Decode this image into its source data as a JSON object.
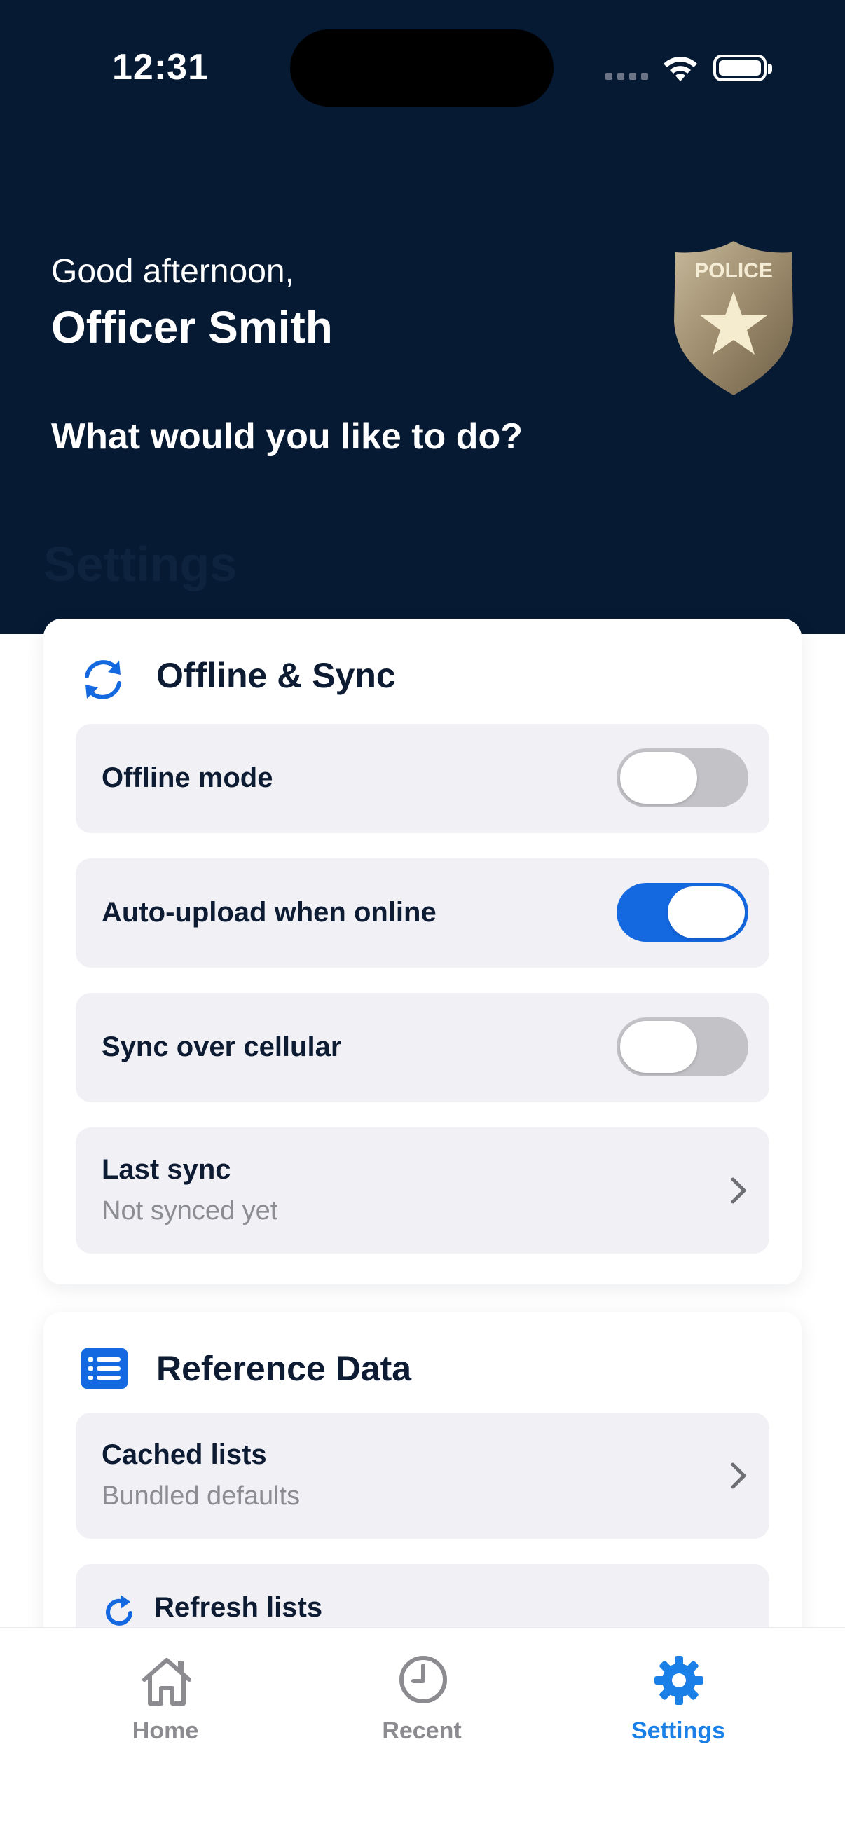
{
  "status_bar": {
    "time": "12:31"
  },
  "header": {
    "greeting": "Good afternoon,",
    "officer_name": "Officer Smith",
    "prompt": "What would you like to do?",
    "section_title": "Settings",
    "badge_text": "POLICE"
  },
  "offline_sync": {
    "title": "Offline & Sync",
    "offline_mode": {
      "label": "Offline mode",
      "enabled": false
    },
    "auto_upload": {
      "label": "Auto-upload when online",
      "enabled": true
    },
    "sync_cellular": {
      "label": "Sync over cellular",
      "enabled": false
    },
    "last_sync": {
      "label": "Last sync",
      "value": "Not synced yet"
    }
  },
  "reference_data": {
    "title": "Reference Data",
    "cached_lists": {
      "label": "Cached lists",
      "value": "Bundled defaults"
    },
    "refresh_lists": {
      "label": "Refresh lists"
    }
  },
  "tabs": [
    {
      "label": "Home",
      "icon": "house-icon",
      "active": false
    },
    {
      "label": "Recent",
      "icon": "clock-icon",
      "active": false
    },
    {
      "label": "Settings",
      "icon": "gear-icon",
      "active": true
    }
  ],
  "colors": {
    "header_bg": "#071a33",
    "accent": "#1468e0",
    "tab_active": "#1a7fe6"
  }
}
